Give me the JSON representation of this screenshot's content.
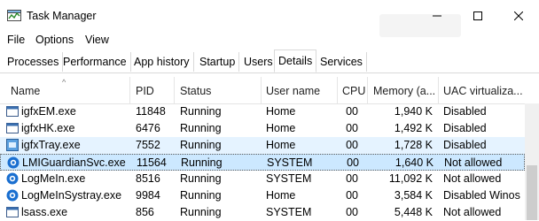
{
  "window": {
    "title": "Task Manager"
  },
  "menu": [
    {
      "label": "File",
      "name": "menu-file"
    },
    {
      "label": "Options",
      "name": "menu-options"
    },
    {
      "label": "View",
      "name": "menu-view"
    }
  ],
  "tabs": [
    {
      "label": "Processes",
      "name": "tab-processes"
    },
    {
      "label": "Performance",
      "name": "tab-performance"
    },
    {
      "label": "App history",
      "name": "tab-app-history"
    },
    {
      "label": "Startup",
      "name": "tab-startup"
    },
    {
      "label": "Users",
      "name": "tab-users"
    },
    {
      "label": "Details",
      "name": "tab-details",
      "active": true
    },
    {
      "label": "Services",
      "name": "tab-services"
    }
  ],
  "columns": [
    {
      "label": "Name",
      "key": "name"
    },
    {
      "label": "PID",
      "key": "pid"
    },
    {
      "label": "Status",
      "key": "status"
    },
    {
      "label": "User name",
      "key": "user"
    },
    {
      "label": "CPU",
      "key": "cpu"
    },
    {
      "label": "Memory (a...",
      "key": "memory"
    },
    {
      "label": "UAC virtualiza...",
      "key": "uac"
    }
  ],
  "processes": [
    {
      "icon": "window-app-icon",
      "name": "igfxEM.exe",
      "pid": "11848",
      "status": "Running",
      "user": "Home",
      "cpu": "00",
      "memory": "1,940 K",
      "uac": "Disabled"
    },
    {
      "icon": "window-app-icon",
      "name": "igfxHK.exe",
      "pid": "6476",
      "status": "Running",
      "user": "Home",
      "cpu": "00",
      "memory": "1,492 K",
      "uac": "Disabled"
    },
    {
      "icon": "intel-graphics-icon",
      "name": "igfxTray.exe",
      "pid": "7552",
      "status": "Running",
      "user": "Home",
      "cpu": "00",
      "memory": "1,728 K",
      "uac": "Disabled",
      "state": "hover"
    },
    {
      "icon": "logmein-icon",
      "name": "LMIGuardianSvc.exe",
      "pid": "11564",
      "status": "Running",
      "user": "SYSTEM",
      "cpu": "00",
      "memory": "1,640 K",
      "uac": "Not allowed",
      "state": "selected"
    },
    {
      "icon": "logmein-icon",
      "name": "LogMeIn.exe",
      "pid": "8516",
      "status": "Running",
      "user": "SYSTEM",
      "cpu": "00",
      "memory": "11,092 K",
      "uac": "Not allowed"
    },
    {
      "icon": "logmein-icon",
      "name": "LogMeInSystray.exe",
      "pid": "9984",
      "status": "Running",
      "user": "Home",
      "cpu": "00",
      "memory": "3,584 K",
      "uac": "Disabled Winos"
    },
    {
      "icon": "window-app-icon",
      "name": "lsass.exe",
      "pid": "856",
      "status": "Running",
      "user": "SYSTEM",
      "cpu": "00",
      "memory": "5,448 K",
      "uac": "Not allowed"
    }
  ]
}
